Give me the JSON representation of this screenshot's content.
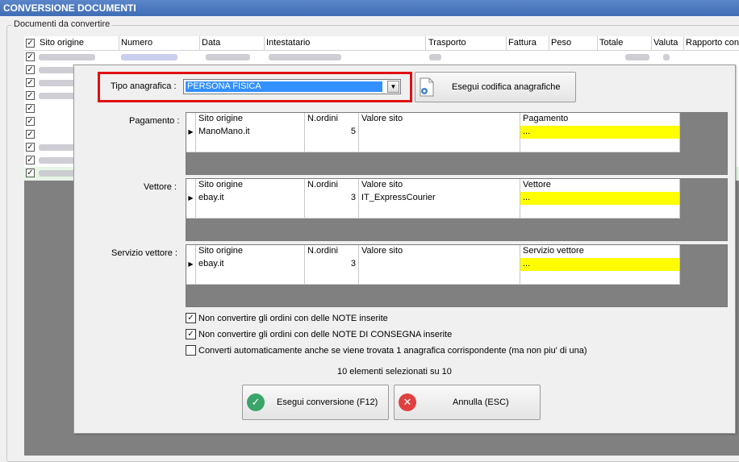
{
  "window": {
    "title": "CONVERSIONE DOCUMENTI"
  },
  "group": {
    "label": "Documenti da convertire"
  },
  "bg_table": {
    "columns": [
      "Sito origine",
      "Numero",
      "Data",
      "Intestatario",
      "Trasporto",
      "Fattura",
      "Peso",
      "Totale",
      "Valuta",
      "Rapporto con"
    ],
    "rows_checked": [
      true,
      true,
      true,
      true,
      true,
      true,
      true,
      true,
      true,
      true
    ]
  },
  "dialog": {
    "tipo_label": "Tipo anagrafica :",
    "tipo_value": "PERSONA FISICA",
    "codifica_button": "Esegui codifica anagrafiche",
    "sections": [
      {
        "label": "Pagamento :",
        "headers": [
          "Sito origine",
          "N.ordini",
          "Valore sito",
          "Pagamento"
        ],
        "rows": [
          {
            "sito": "ManoMano.it",
            "n": "5",
            "valore": "",
            "target": "..."
          }
        ]
      },
      {
        "label": "Vettore :",
        "headers": [
          "Sito origine",
          "N.ordini",
          "Valore sito",
          "Vettore"
        ],
        "rows": [
          {
            "sito": "ebay.it",
            "n": "3",
            "valore": "IT_ExpressCourier",
            "target": "..."
          }
        ]
      },
      {
        "label": "Servizio vettore :",
        "headers": [
          "Sito origine",
          "N.ordini",
          "Valore sito",
          "Servizio vettore"
        ],
        "rows": [
          {
            "sito": "ebay.it",
            "n": "3",
            "valore": "",
            "target": "..."
          }
        ]
      }
    ],
    "options": [
      {
        "label": "Non convertire gli ordini con delle NOTE inserite",
        "checked": true
      },
      {
        "label": "Non convertire gli ordini con delle NOTE DI CONSEGNA inserite",
        "checked": true
      },
      {
        "label": "Converti automaticamente anche se viene trovata 1 anagrafica corrispondente (ma non piu' di una)",
        "checked": false
      }
    ],
    "status": "10 elementi selezionati su 10",
    "convert_button": "Esegui conversione (F12)",
    "cancel_button": "Annulla (ESC)"
  },
  "colors": {
    "highlight": "#3390ff",
    "target_cell": "#ffff00",
    "alert": "#e01010",
    "ok_icon": "#3aa56a",
    "cancel_icon": "#e04040"
  }
}
